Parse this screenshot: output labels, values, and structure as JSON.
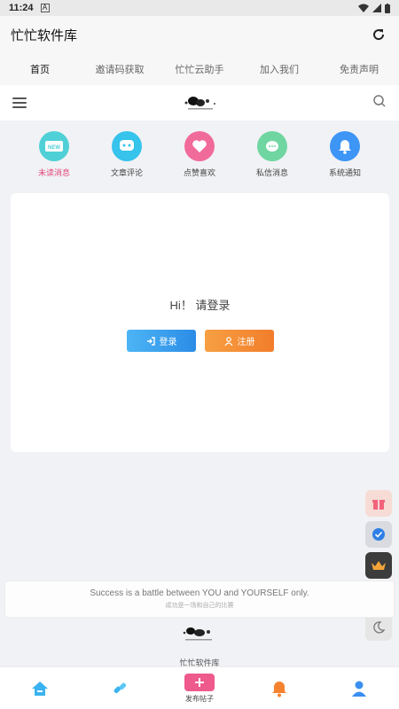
{
  "status_bar": {
    "time": "11:24",
    "notification_glyph": "A"
  },
  "app_bar": {
    "title": "忙忙软件库",
    "refresh_icon": "refresh-icon"
  },
  "tabs": [
    {
      "label": "首页",
      "active": true
    },
    {
      "label": "邀请码获取",
      "active": false
    },
    {
      "label": "忙忙云助手",
      "active": false
    },
    {
      "label": "加入我们",
      "active": false
    },
    {
      "label": "免责声明",
      "active": false
    }
  ],
  "quick_icons": [
    {
      "label": "未读消息",
      "icon": "new-badge-icon",
      "color": "#4fd0d6",
      "badge_text": "NEW"
    },
    {
      "label": "文章评论",
      "icon": "chat-icon",
      "color": "#36c3ec"
    },
    {
      "label": "点赞喜欢",
      "icon": "heart-icon",
      "color": "#f16b9a"
    },
    {
      "label": "私信消息",
      "icon": "message-icon",
      "color": "#6fd6a2"
    },
    {
      "label": "系统通知",
      "icon": "bell-icon",
      "color": "#3d95f5"
    }
  ],
  "login_card": {
    "greeting": "Hi！ 请登录",
    "login_label": "登录",
    "register_label": "注册"
  },
  "quote": {
    "english": "Success is a battle between YOU and YOURSELF only.",
    "chinese": "成功是一场和自己的比赛"
  },
  "footer": {
    "site_name": "忙忙软件库"
  },
  "floating_buttons": [
    {
      "icon": "gift-icon",
      "bg": "#f7dcd6"
    },
    {
      "icon": "verified-icon",
      "bg": "#d9dbe0"
    },
    {
      "icon": "crown-icon",
      "bg": "#3c3c3c"
    },
    {
      "icon": "qq-icon",
      "bg": "#dcdcdc"
    },
    {
      "icon": "moon-icon",
      "bg": "#e6e6e6"
    }
  ],
  "bottom_nav": {
    "publish_label": "发布帖子"
  },
  "colors": {
    "accent_blue": "#2b8ce6",
    "accent_orange": "#f27d2b",
    "accent_pink": "#ef5a8d"
  }
}
